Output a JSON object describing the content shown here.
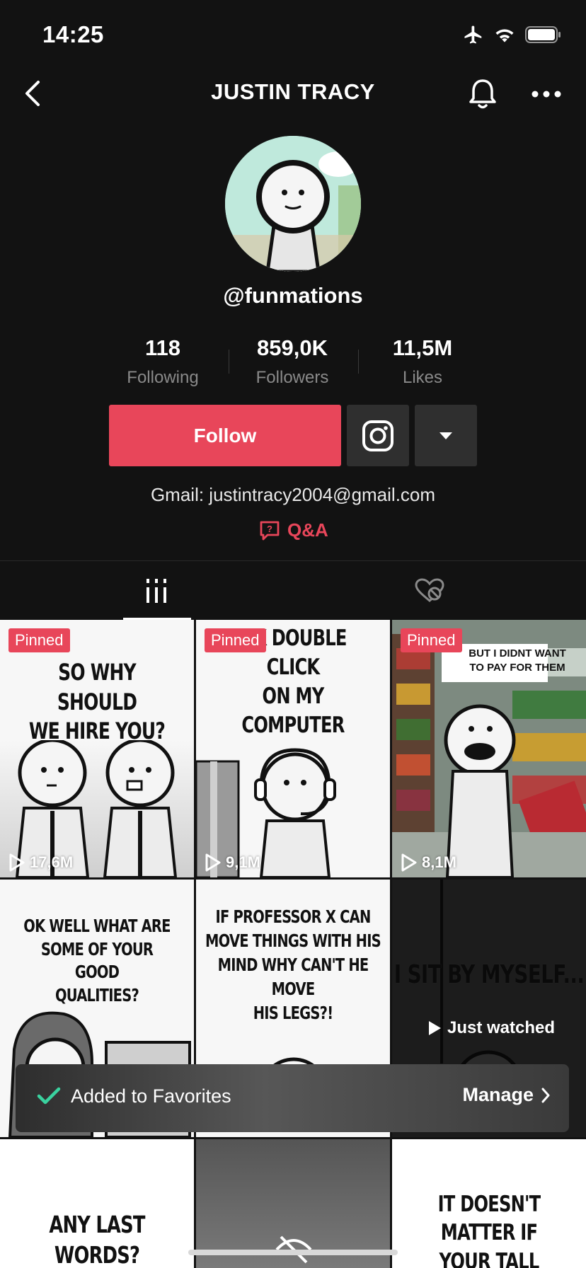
{
  "status_bar": {
    "time": "14:25",
    "icons": [
      "airplane-icon",
      "wifi-icon",
      "battery-icon"
    ]
  },
  "header": {
    "title": "JUSTIN TRACY",
    "icons": [
      "back-icon",
      "bell-icon",
      "more-icon"
    ]
  },
  "profile": {
    "username": "@funmations",
    "stats": [
      {
        "value": "118",
        "label": "Following"
      },
      {
        "value": "859,0K",
        "label": "Followers"
      },
      {
        "value": "11,5M",
        "label": "Likes"
      }
    ],
    "follow_label": "Follow",
    "bio": "Gmail: justintracy2004@gmail.com",
    "qa_label": "Q&A"
  },
  "tabs": {
    "icons": [
      "videos-grid-icon",
      "liked-hidden-icon"
    ],
    "active": 0
  },
  "grid": [
    {
      "caption": [
        "SO WHY SHOULD",
        "WE HIRE YOU?"
      ],
      "pinned": "Pinned",
      "views": "17,6M"
    },
    {
      "caption": [
        "OK DOUBLE",
        "CLICK",
        "ON MY",
        "COMPUTER"
      ],
      "pinned": "Pinned",
      "views": "9,1M"
    },
    {
      "caption": [
        "BUT I DIDNT WANT",
        "TO PAY FOR THEM"
      ],
      "pinned": "Pinned",
      "views": "8,1M"
    },
    {
      "caption": [
        "OK WELL WHAT ARE",
        "SOME OF YOUR GOOD",
        "QUALITIES?"
      ]
    },
    {
      "caption": [
        "IF PROFESSOR X CAN",
        "MOVE THINGS WITH HIS",
        "MIND WHY CAN'T HE MOVE",
        "HIS LEGS?!"
      ]
    },
    {
      "caption": [
        "I SIT BY MYSELF..."
      ],
      "overlay": "Just watched"
    },
    {
      "caption": [
        "ANY LAST",
        "WORDS?"
      ]
    },
    {
      "caption": []
    },
    {
      "caption": [
        "IT DOESN'T",
        "MATTER IF",
        "YOUR TALL"
      ]
    }
  ],
  "toast": {
    "text": "Added to Favorites",
    "action": "Manage"
  },
  "colors": {
    "background": "#121212",
    "accent": "#e8465a",
    "secondary_button": "#2f2f2f",
    "muted_text": "#8a8a8a",
    "toast_check": "#3ad29f"
  }
}
